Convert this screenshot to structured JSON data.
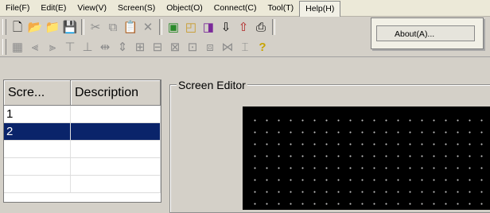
{
  "menu": {
    "items": [
      "File(F)",
      "Edit(E)",
      "View(V)",
      "Screen(S)",
      "Object(O)",
      "Connect(C)",
      "Tool(T)",
      "Help(H)"
    ],
    "open_index": 7
  },
  "help_menu": {
    "items": [
      "About(A)..."
    ]
  },
  "toolbar1": {
    "icons": [
      "new-file-icon",
      "open-folder-icon",
      "open-project-icon",
      "save-icon",
      "cut-icon",
      "copy-icon",
      "paste-icon",
      "delete-icon",
      "new-screen-icon",
      "screen-properties-icon",
      "object-icon",
      "download-icon",
      "upload-icon",
      "print-icon"
    ]
  },
  "toolbar2": {
    "icons": [
      "grid-icon",
      "align-left-icon",
      "align-right-icon",
      "align-top-icon",
      "align-bottom-icon",
      "distribute-horizontal-icon",
      "distribute-vertical-icon",
      "same-width-icon",
      "same-height-icon",
      "same-size-icon",
      "center-horizontal-icon",
      "center-vertical-icon",
      "space-horizontal-icon",
      "space-vertical-icon",
      "help-icon"
    ]
  },
  "screen_list": {
    "columns": [
      "Scre...",
      "Description"
    ],
    "rows": [
      {
        "id": "1",
        "description": ""
      },
      {
        "id": "2",
        "description": ""
      },
      {
        "id": "",
        "description": ""
      },
      {
        "id": "",
        "description": ""
      },
      {
        "id": "",
        "description": ""
      }
    ],
    "selected_index": 1
  },
  "editor": {
    "title": "Screen Editor",
    "canvas_color": "#000000",
    "grid_color": "#bfbfbf"
  }
}
